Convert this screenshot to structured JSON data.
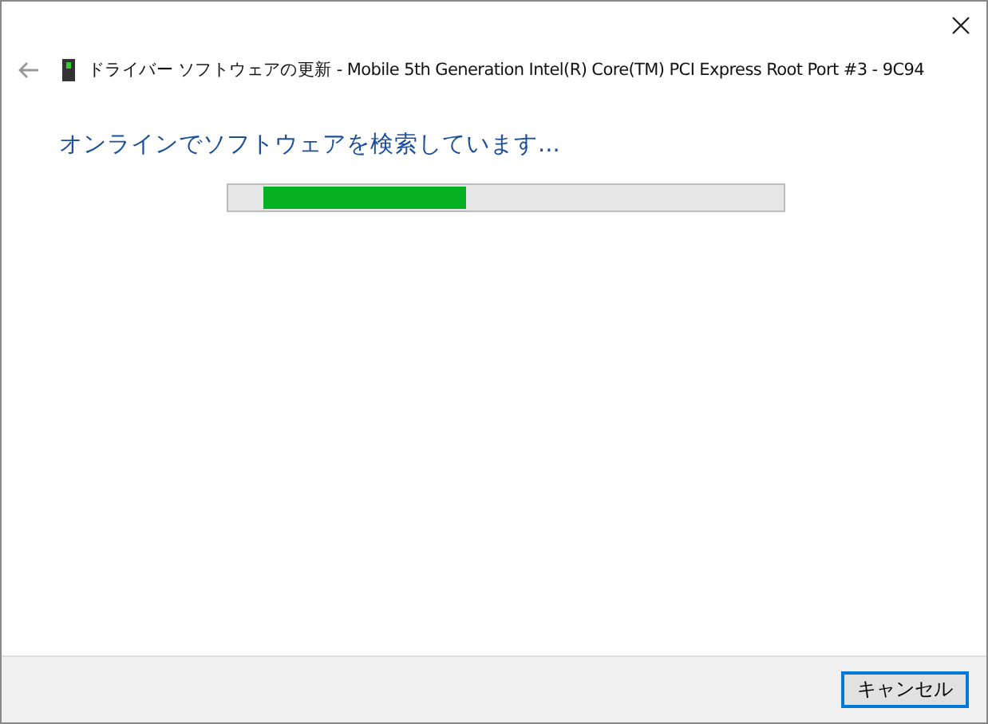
{
  "window": {
    "title": "ドライバー ソフトウェアの更新 - Mobile 5th Generation Intel(R) Core(TM) PCI Express Root Port #3 - 9C94"
  },
  "heading": "オンラインでソフトウェアを検索しています...",
  "buttons": [
    "キャンセル"
  ]
}
